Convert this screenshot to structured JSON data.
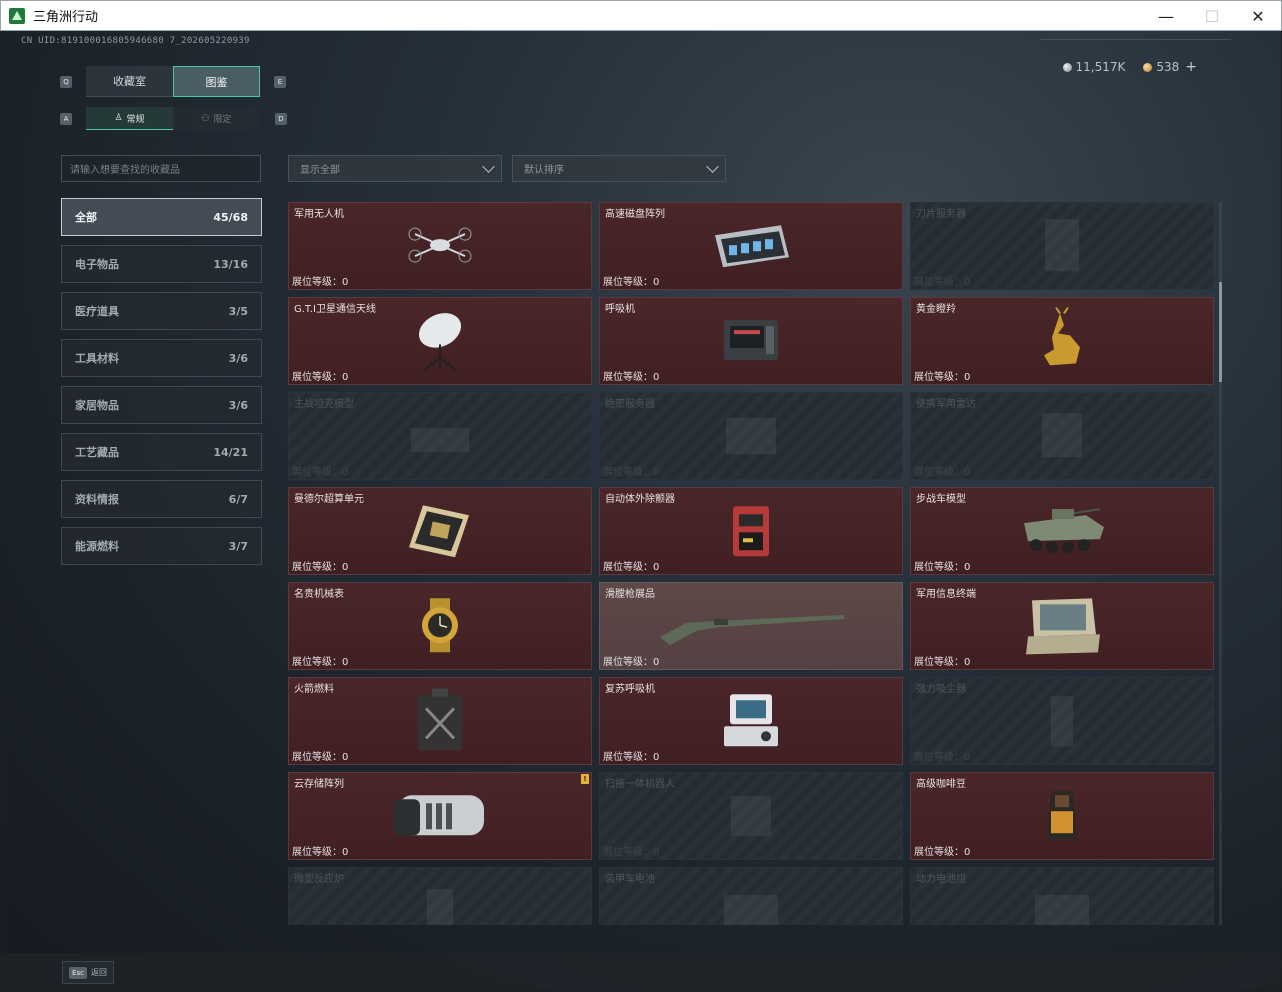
{
  "window": {
    "title": "三角洲行动",
    "minimize": "—",
    "maximize": "☐",
    "close": "✕"
  },
  "header": {
    "uid": "CN UID:819100016805946680 7_202605220939",
    "currency_silver": "11,517K",
    "currency_gold": "538",
    "plus": "+"
  },
  "tabs": {
    "main": [
      "收藏室",
      "图鉴"
    ],
    "main_active": 1,
    "sub": [
      "常规",
      "限定"
    ],
    "sub_active": 0,
    "key_left": "Q",
    "key_right": "E",
    "sub_key_left": "A",
    "sub_key_right": "D"
  },
  "search": {
    "placeholder": "请输入想要查找的收藏品"
  },
  "filters": {
    "show": "显示全部",
    "sort": "默认排序"
  },
  "categories": [
    {
      "label": "全部",
      "count": "45/68",
      "active": true
    },
    {
      "label": "电子物品",
      "count": "13/16"
    },
    {
      "label": "医疗道具",
      "count": "3/5"
    },
    {
      "label": "工具材料",
      "count": "3/6"
    },
    {
      "label": "家居物品",
      "count": "3/6"
    },
    {
      "label": "工艺藏品",
      "count": "14/21"
    },
    {
      "label": "资料情报",
      "count": "6/7"
    },
    {
      "label": "能源燃料",
      "count": "3/7"
    }
  ],
  "level_label": "展位等级：0",
  "items": [
    {
      "name": "军用无人机",
      "state": "owned",
      "icon": "drone-icon"
    },
    {
      "name": "高速磁盘阵列",
      "state": "owned",
      "icon": "disk-array-icon"
    },
    {
      "name": "刀片服务器",
      "state": "locked",
      "icon": "blade-server-icon"
    },
    {
      "name": "G.T.I卫星通信天线",
      "state": "owned",
      "icon": "satellite-dish-icon"
    },
    {
      "name": "呼吸机",
      "state": "owned",
      "icon": "ventilator-icon"
    },
    {
      "name": "黄金瞪羚",
      "state": "owned",
      "icon": "gold-gazelle-icon"
    },
    {
      "name": "主战坦克模型",
      "state": "locked",
      "icon": "tank-model-icon"
    },
    {
      "name": "绝密服务器",
      "state": "locked",
      "icon": "server-icon"
    },
    {
      "name": "便携军用雷达",
      "state": "locked",
      "icon": "radar-icon"
    },
    {
      "name": "曼德尔超算单元",
      "state": "owned",
      "icon": "supercompute-unit-icon"
    },
    {
      "name": "自动体外除颤器",
      "state": "owned",
      "icon": "defibrillator-icon"
    },
    {
      "name": "步战车模型",
      "state": "owned",
      "icon": "ifv-model-icon"
    },
    {
      "name": "名贵机械表",
      "state": "owned",
      "icon": "watch-icon"
    },
    {
      "name": "滑膛枪展品",
      "state": "selected",
      "icon": "musket-icon"
    },
    {
      "name": "军用信息终端",
      "state": "owned",
      "icon": "info-terminal-icon"
    },
    {
      "name": "火箭燃料",
      "state": "owned",
      "icon": "rocket-fuel-icon"
    },
    {
      "name": "复苏呼吸机",
      "state": "owned",
      "icon": "resuscitator-icon"
    },
    {
      "name": "强力吸尘器",
      "state": "locked",
      "icon": "vacuum-icon"
    },
    {
      "name": "云存储阵列",
      "state": "owned",
      "icon": "cloud-storage-icon",
      "flag": "!"
    },
    {
      "name": "扫拖一体机器人",
      "state": "locked",
      "icon": "mop-robot-icon"
    },
    {
      "name": "高级咖啡豆",
      "state": "owned",
      "icon": "coffee-beans-icon"
    },
    {
      "name": "微型反应炉",
      "state": "locked",
      "icon": "reactor-icon"
    },
    {
      "name": "装甲车电池",
      "state": "locked",
      "icon": "battery-icon"
    },
    {
      "name": "动力电池组",
      "state": "locked",
      "icon": "power-pack-icon"
    }
  ],
  "footer": {
    "esc_key": "Esc",
    "esc_label": "返回"
  },
  "colors": {
    "accent": "#46c9a8",
    "owned_bg": "#4a2629",
    "locked_bg": "#262c32"
  }
}
